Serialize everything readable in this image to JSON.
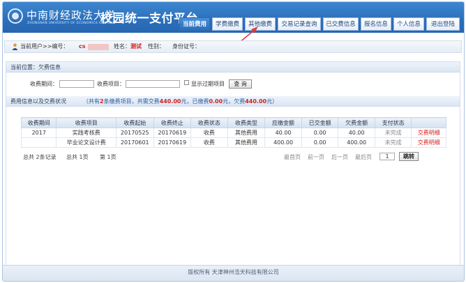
{
  "header": {
    "logo_text": "中南财经政法大学",
    "logo_sub": "ZHONGNAN UNIVERSITY OF ECONOMICS AND LAW",
    "site_title": "校园统一支付平台",
    "nav": [
      {
        "label": "当前费用",
        "active": true
      },
      {
        "label": "学费缴费",
        "active": false
      },
      {
        "label": "其他缴费",
        "active": false
      },
      {
        "label": "交易记录查询",
        "active": false
      },
      {
        "label": "已交费信息",
        "active": false
      },
      {
        "label": "报名信息",
        "active": false
      },
      {
        "label": "个人信息",
        "active": false
      },
      {
        "label": "退出登陆",
        "active": false
      }
    ]
  },
  "userbar": {
    "current_user": "当前用户>>编号：",
    "id_prefix": "cs",
    "name_label": "姓名：",
    "name_value": "测试",
    "gender_label": "性别：",
    "idcard_label": "身份证号："
  },
  "location": "当前位置：欠费信息",
  "filter": {
    "period_label": "收费期间：",
    "item_label": "收费项目：",
    "expired_label": "显示过期项目",
    "query_button": "查 询"
  },
  "summary": {
    "label": "费用信息以及交费状况",
    "t1": "（共有",
    "count": "2",
    "t2": "条缴费项目，共需交费",
    "total": "440.00",
    "t3": "元，已缴费",
    "paid": "0.00",
    "t4": "元，欠费",
    "owed": "440.00",
    "t5": "元）"
  },
  "table": {
    "columns": [
      "收费期间",
      "收费项目",
      "收费起始",
      "收费终止",
      "收费状态",
      "收费类型",
      "应缴金额",
      "已交金额",
      "欠费金额",
      "支付状态",
      ""
    ],
    "rows": [
      {
        "period": "2017",
        "item": "实践考核费",
        "start": "20170525",
        "end": "20170619",
        "status": "收费",
        "type": "其他费用",
        "due": "40.00",
        "paid": "0.00",
        "owed": "40.00",
        "pay_status": "未完成",
        "detail": "交费明细"
      },
      {
        "period": "",
        "item": "毕业论文设计费",
        "start": "20170601",
        "end": "20170619",
        "status": "收费",
        "type": "其他费用",
        "due": "400.00",
        "paid": "0.00",
        "owed": "400.00",
        "pay_status": "未完成",
        "detail": "交费明细"
      }
    ]
  },
  "pager": {
    "total": "总共  2条记录",
    "pages": "总共  1页",
    "current": "第 1页",
    "first": "最首页",
    "prev": "前一页",
    "next": "后一页",
    "last": "最后页",
    "page_input": "1",
    "go_button": "跳转"
  },
  "footer": "版权所有 天津神州浩天科技有限公司"
}
